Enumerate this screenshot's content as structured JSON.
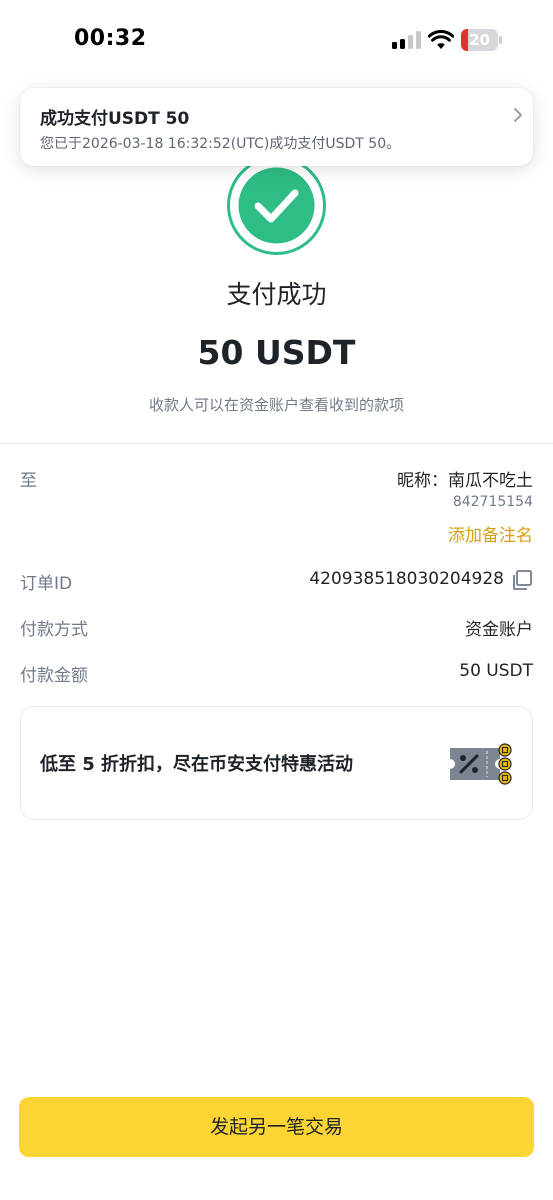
{
  "status_bar": {
    "time": "00:32",
    "battery": "20"
  },
  "notification": {
    "title": "成功支付USDT 50",
    "body": "您已于2026-03-18 16:32:52(UTC)成功支付USDT 50。"
  },
  "result": {
    "title": "支付成功",
    "amount": "50 USDT",
    "subtitle": "收款人可以在资金账户查看收到的款项"
  },
  "details": {
    "to_label": "至",
    "recipient_name": "昵称：南瓜不吃土",
    "recipient_id": "842715154",
    "add_note": "添加备注名",
    "order_label": "订单ID",
    "order_id": "420938518030204928",
    "method_label": "付款方式",
    "method_value": "资金账户",
    "amount_label": "付款金额",
    "amount_value": "50 USDT"
  },
  "promo": {
    "text": "低至 5 折折扣，尽在币安支付特惠活动"
  },
  "actions": {
    "new_transaction": "发起另一笔交易"
  },
  "colors": {
    "accent_yellow": "#FCD535",
    "success_green": "#2EBD85",
    "link_gold": "#D89F0B",
    "battery_red": "#E3312B"
  },
  "icons": [
    "signal-icon",
    "wifi-icon",
    "battery-icon",
    "chevron-right-icon",
    "check-circle-icon",
    "copy-icon",
    "coupon-icon"
  ]
}
